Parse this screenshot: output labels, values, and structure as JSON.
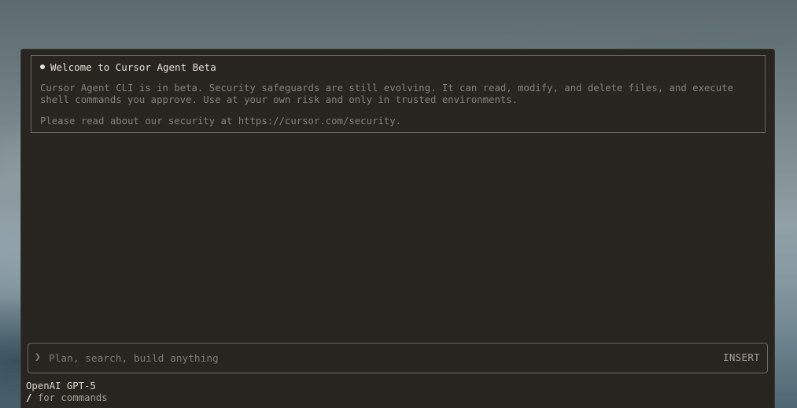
{
  "welcome": {
    "title": "Welcome to Cursor Agent Beta",
    "body": "Cursor Agent CLI is in beta. Security safeguards are still evolving. It can read, modify, and delete files, and execute shell commands you approve. Use at your own risk and only in trusted environments.",
    "security_note": "Please read about our security at https://cursor.com/security."
  },
  "prompt": {
    "icon": "chevron-right-icon",
    "placeholder": "Plan, search, build anything",
    "value": "",
    "mode": "INSERT"
  },
  "status": {
    "model": "OpenAI GPT-5",
    "commands_key": "/",
    "commands_hint": "for commands"
  },
  "colors": {
    "terminal_bg": "#282520",
    "border": "#6c675f",
    "text_primary": "#e4dfd6",
    "text_muted": "#86807a"
  }
}
